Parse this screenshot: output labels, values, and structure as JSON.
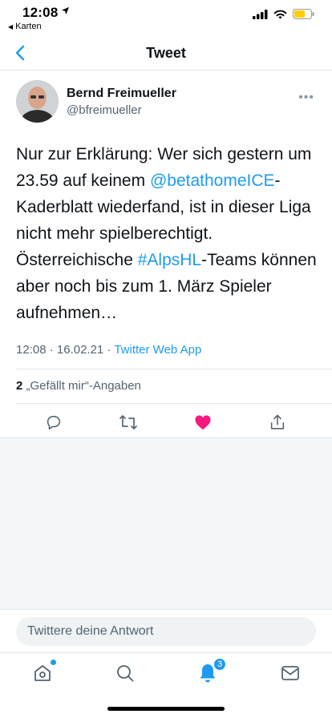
{
  "status": {
    "time": "12:08",
    "back_app": "Karten"
  },
  "nav": {
    "title": "Tweet"
  },
  "tweet": {
    "author_name": "Bernd Freimueller",
    "author_handle": "@bfreimueller",
    "text_1": "Nur zur Erklärung: Wer sich gestern um 23.59 auf keinem ",
    "mention": "@betathomeICE",
    "text_2": "-Kaderblatt wiederfand, ist in dieser Liga nicht mehr spielberechtigt. Österreichische ",
    "hashtag": "#AlpsHL",
    "text_3": "-Teams können aber noch bis zum 1. März Spieler aufnehmen…",
    "time": "12:08",
    "date": "16.02.21",
    "source": "Twitter Web App",
    "likes_count": "2",
    "likes_label": "„Gefällt mir“-Angaben"
  },
  "reply": {
    "placeholder": "Twittere deine Antwort"
  },
  "tabs": {
    "notifications_badge": "3"
  },
  "colors": {
    "accent": "#1d9bf0",
    "like": "#f91880"
  }
}
